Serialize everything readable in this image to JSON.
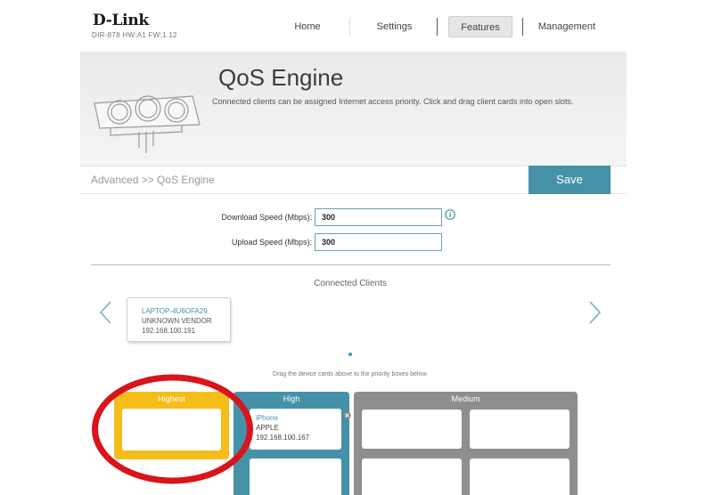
{
  "header": {
    "logo": "D-Link",
    "model_info": "DIR-878 HW:A1 FW:1.12",
    "nav": {
      "home": "Home",
      "settings": "Settings",
      "features": "Features",
      "management": "Management"
    }
  },
  "banner": {
    "title": "QoS Engine",
    "description": "Connected clients can be assigned Internet access priority. Click and drag client cards into open slots."
  },
  "breadcrumb": "Advanced >> QoS Engine",
  "save_label": "Save",
  "speed": {
    "download_label": "Download Speed (Mbps):",
    "download_value": "300",
    "upload_label": "Upload Speed (Mbps):",
    "upload_value": "300"
  },
  "clients": {
    "title": "Connected Clients",
    "cards": [
      {
        "name": "LAPTOP-4U6OFA29",
        "vendor": "UNKNOWN VENDOR",
        "ip": "192.168.100.191"
      }
    ],
    "drag_hint": "Drag the device cards above to the priority boxes below."
  },
  "priorities": {
    "highest": {
      "title": "Highest"
    },
    "high": {
      "title": "High",
      "devices": [
        {
          "name": "iPhone",
          "vendor": "APPLE",
          "ip": "192.168.100.167"
        }
      ]
    },
    "medium": {
      "title": "Medium"
    }
  },
  "colors": {
    "accent": "#4592a8",
    "highest": "#f5bd1a",
    "medium": "#8e8e8e",
    "annotation": "#d9141c"
  },
  "icons": {
    "info": "info-icon",
    "prev": "chevron-left-icon",
    "next": "chevron-right-icon",
    "remove": "close-icon"
  }
}
